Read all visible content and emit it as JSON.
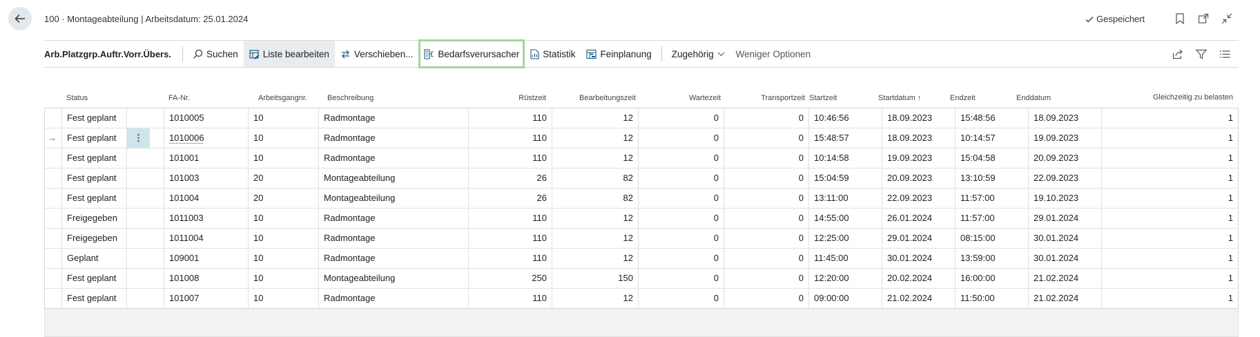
{
  "header": {
    "title": "100 · Montageabteilung | Arbeitsdatum: 25.01.2024",
    "status": "Gespeichert"
  },
  "actionbar": {
    "title": "Arb.Platzgrp.Auftr.Vorr.Übers.",
    "buttons": {
      "search": "Suchen",
      "edit_list": "Liste bearbeiten",
      "move": "Verschieben...",
      "demand": "Bedarfsverursacher",
      "statistics": "Statistik",
      "fine_planning": "Feinplanung",
      "related": "Zugehörig",
      "fewer_options": "Weniger Optionen"
    }
  },
  "table": {
    "columns": {
      "status": "Status",
      "fa_nr": "FA-Nr.",
      "operation_no": "Arbeitsgangnr.",
      "description": "Beschreibung",
      "setup_time": "Rüstzeit",
      "run_time": "Bearbeitungszeit",
      "wait_time": "Wartezeit",
      "move_time": "Transportzeit",
      "start_time": "Startzeit",
      "start_date": "Startdatum ↑",
      "end_time": "Endzeit",
      "end_date": "Enddatum",
      "concurrent": "Gleichzeitig zu belasten"
    },
    "rows": [
      {
        "status": "Fest geplant",
        "fa_nr": "1010005",
        "op": "10",
        "desc": "Radmontage",
        "setup": "110",
        "run": "12",
        "wait": "0",
        "move": "0",
        "start_time": "10:46:56",
        "start_date": "18.09.2023",
        "end_time": "15:48:56",
        "end_date": "18.09.2023",
        "concurrent": "1"
      },
      {
        "status": "Fest geplant",
        "fa_nr": "1010006",
        "op": "10",
        "desc": "Radmontage",
        "setup": "110",
        "run": "12",
        "wait": "0",
        "move": "0",
        "start_time": "15:48:57",
        "start_date": "18.09.2023",
        "end_time": "10:14:57",
        "end_date": "19.09.2023",
        "concurrent": "1"
      },
      {
        "status": "Fest geplant",
        "fa_nr": "101001",
        "op": "10",
        "desc": "Radmontage",
        "setup": "110",
        "run": "12",
        "wait": "0",
        "move": "0",
        "start_time": "10:14:58",
        "start_date": "19.09.2023",
        "end_time": "15:04:58",
        "end_date": "20.09.2023",
        "concurrent": "1"
      },
      {
        "status": "Fest geplant",
        "fa_nr": "101003",
        "op": "20",
        "desc": "Montageabteilung",
        "setup": "26",
        "run": "82",
        "wait": "0",
        "move": "0",
        "start_time": "15:04:59",
        "start_date": "20.09.2023",
        "end_time": "13:10:59",
        "end_date": "22.09.2023",
        "concurrent": "1"
      },
      {
        "status": "Fest geplant",
        "fa_nr": "101004",
        "op": "20",
        "desc": "Montageabteilung",
        "setup": "26",
        "run": "82",
        "wait": "0",
        "move": "0",
        "start_time": "13:11:00",
        "start_date": "22.09.2023",
        "end_time": "11:57:00",
        "end_date": "19.10.2023",
        "concurrent": "1"
      },
      {
        "status": "Freigegeben",
        "fa_nr": "1011003",
        "op": "10",
        "desc": "Radmontage",
        "setup": "110",
        "run": "12",
        "wait": "0",
        "move": "0",
        "start_time": "14:55:00",
        "start_date": "26.01.2024",
        "end_time": "11:57:00",
        "end_date": "29.01.2024",
        "concurrent": "1"
      },
      {
        "status": "Freigegeben",
        "fa_nr": "1011004",
        "op": "10",
        "desc": "Radmontage",
        "setup": "110",
        "run": "12",
        "wait": "0",
        "move": "0",
        "start_time": "12:25:00",
        "start_date": "29.01.2024",
        "end_time": "08:15:00",
        "end_date": "30.01.2024",
        "concurrent": "1"
      },
      {
        "status": "Geplant",
        "fa_nr": "109001",
        "op": "10",
        "desc": "Radmontage",
        "setup": "110",
        "run": "12",
        "wait": "0",
        "move": "0",
        "start_time": "11:45:00",
        "start_date": "30.01.2024",
        "end_time": "13:59:00",
        "end_date": "30.01.2024",
        "concurrent": "1"
      },
      {
        "status": "Fest geplant",
        "fa_nr": "101008",
        "op": "10",
        "desc": "Montageabteilung",
        "setup": "250",
        "run": "150",
        "wait": "0",
        "move": "0",
        "start_time": "12:20:00",
        "start_date": "20.02.2024",
        "end_time": "16:00:00",
        "end_date": "21.02.2024",
        "concurrent": "1"
      },
      {
        "status": "Fest geplant",
        "fa_nr": "101007",
        "op": "10",
        "desc": "Radmontage",
        "setup": "110",
        "run": "12",
        "wait": "0",
        "move": "0",
        "start_time": "09:00:00",
        "start_date": "21.02.2024",
        "end_time": "11:50:00",
        "end_date": "21.02.2024",
        "concurrent": "1"
      }
    ],
    "selected_row": 1,
    "row_indicator": "→",
    "row_menu": "⋮"
  },
  "colors": {
    "highlight_outline": "#9fd99a",
    "selected_cell": "#cce6ec",
    "back_button_bg": "#e3e8ec"
  }
}
